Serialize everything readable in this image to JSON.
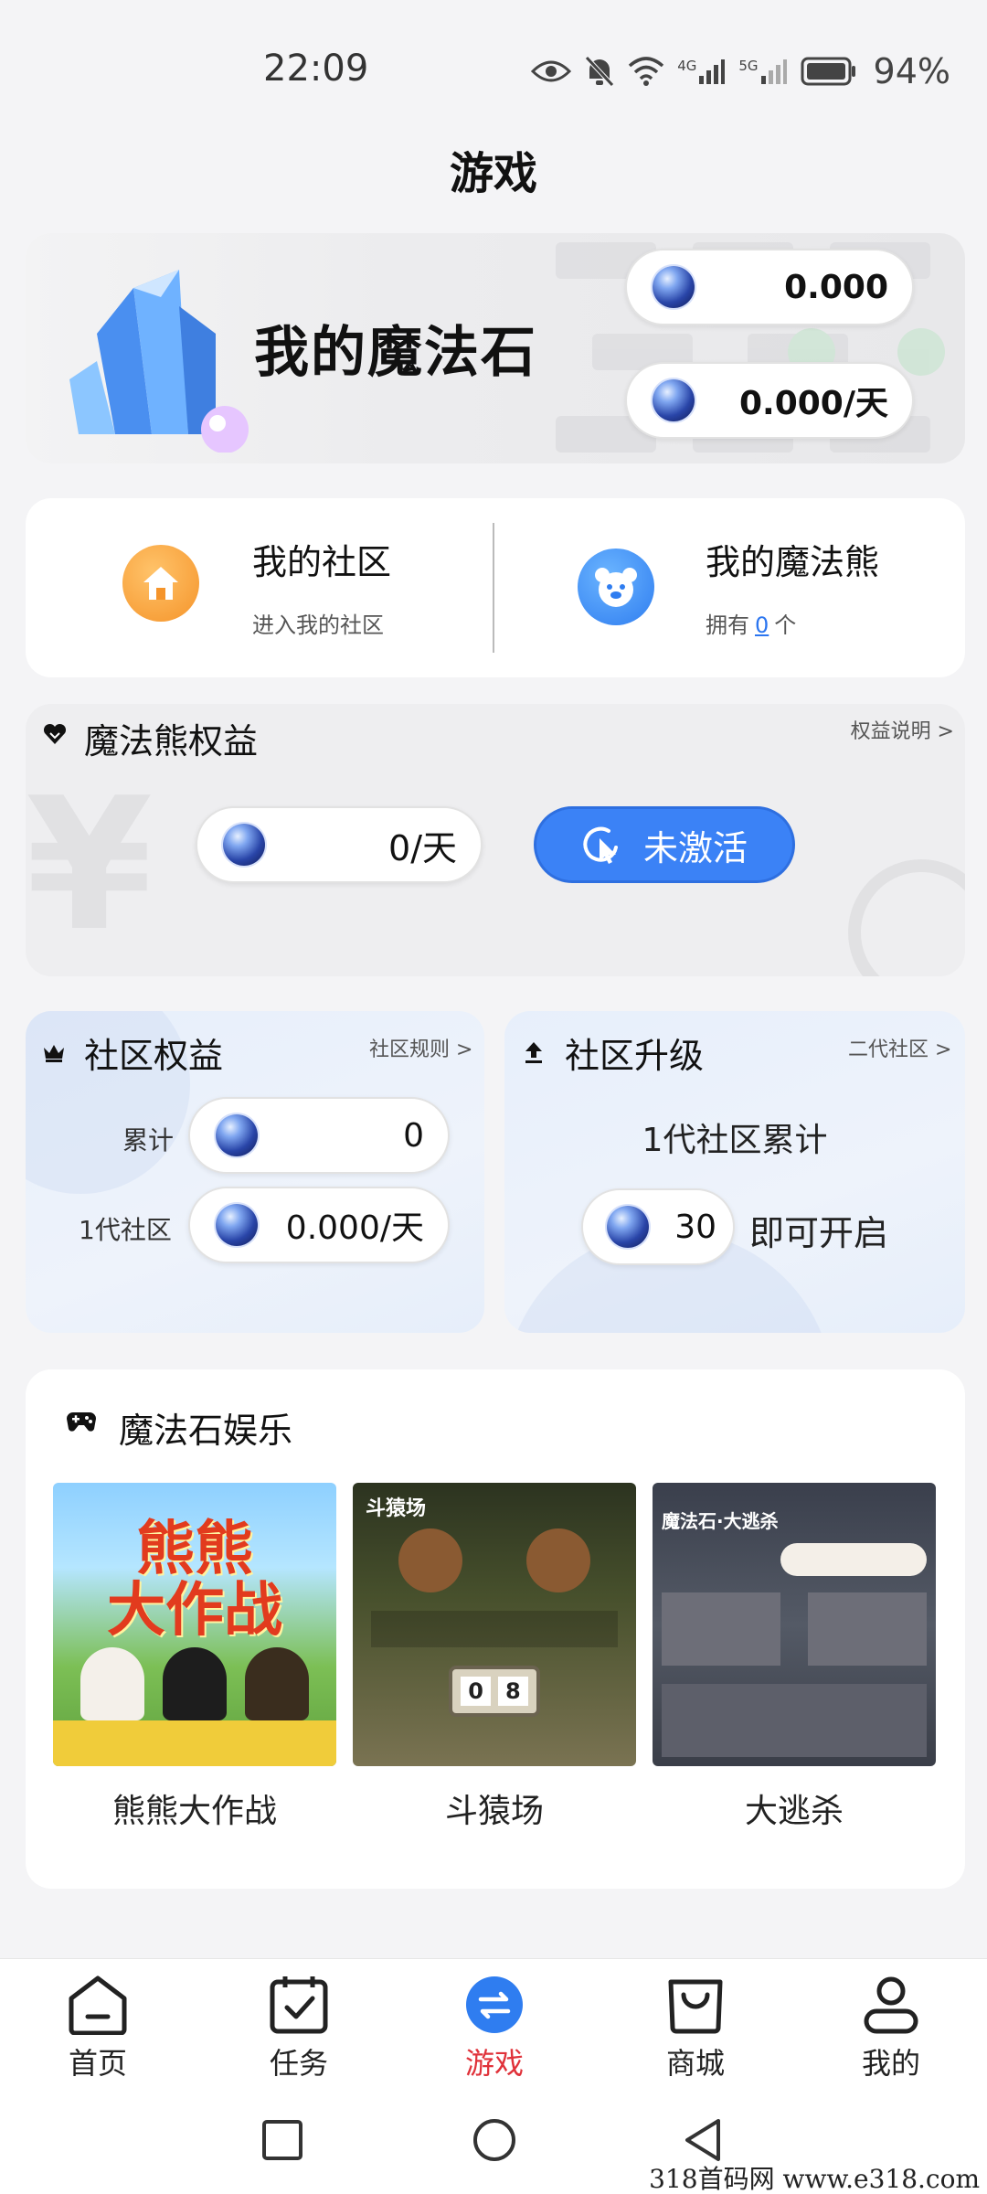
{
  "status_bar": {
    "time": "22:09",
    "battery": "94%",
    "net1": "4G",
    "net2": "5G"
  },
  "page": {
    "title": "游戏"
  },
  "banner": {
    "title": "我的魔法石",
    "balance": "0.000",
    "daily": "0.000/天"
  },
  "community": {
    "title": "我的社区",
    "subtitle": "进入我的社区"
  },
  "bear": {
    "title": "我的魔法熊",
    "owned_prefix": "拥有",
    "owned_count": "0",
    "owned_suffix": "个"
  },
  "bear_rights": {
    "title": "魔法熊权益",
    "link": "权益说明 >",
    "daily": "0/天",
    "activate_label": "未激活"
  },
  "community_rights": {
    "title": "社区权益",
    "link": "社区规则 >",
    "total_label": "累计",
    "total_value": "0",
    "gen1_label": "1代社区",
    "gen1_value": "0.000/天"
  },
  "community_upgrade": {
    "title": "社区升级",
    "link": "二代社区 >",
    "text": "1代社区累计",
    "required": "30",
    "suffix": "即可开启"
  },
  "entertainment": {
    "title": "魔法石娱乐",
    "games": [
      {
        "name": "熊熊大作战",
        "thumb_text": "熊熊\n大作战"
      },
      {
        "name": "斗猿场",
        "thumb_text": "斗猿场"
      },
      {
        "name": "大逃杀",
        "thumb_text": "魔法石·大逃杀"
      }
    ]
  },
  "bottom_nav": {
    "items": [
      {
        "label": "首页",
        "icon": "home-icon"
      },
      {
        "label": "任务",
        "icon": "task-icon"
      },
      {
        "label": "游戏",
        "icon": "game-swap-icon",
        "active": true
      },
      {
        "label": "商城",
        "icon": "bag-icon"
      },
      {
        "label": "我的",
        "icon": "user-icon"
      }
    ]
  },
  "watermark": "318首码网  www.e318.com",
  "colors": {
    "accent_blue": "#3b82f6",
    "active_nav": "#e0323a",
    "orange_icon": "#f5942a"
  }
}
